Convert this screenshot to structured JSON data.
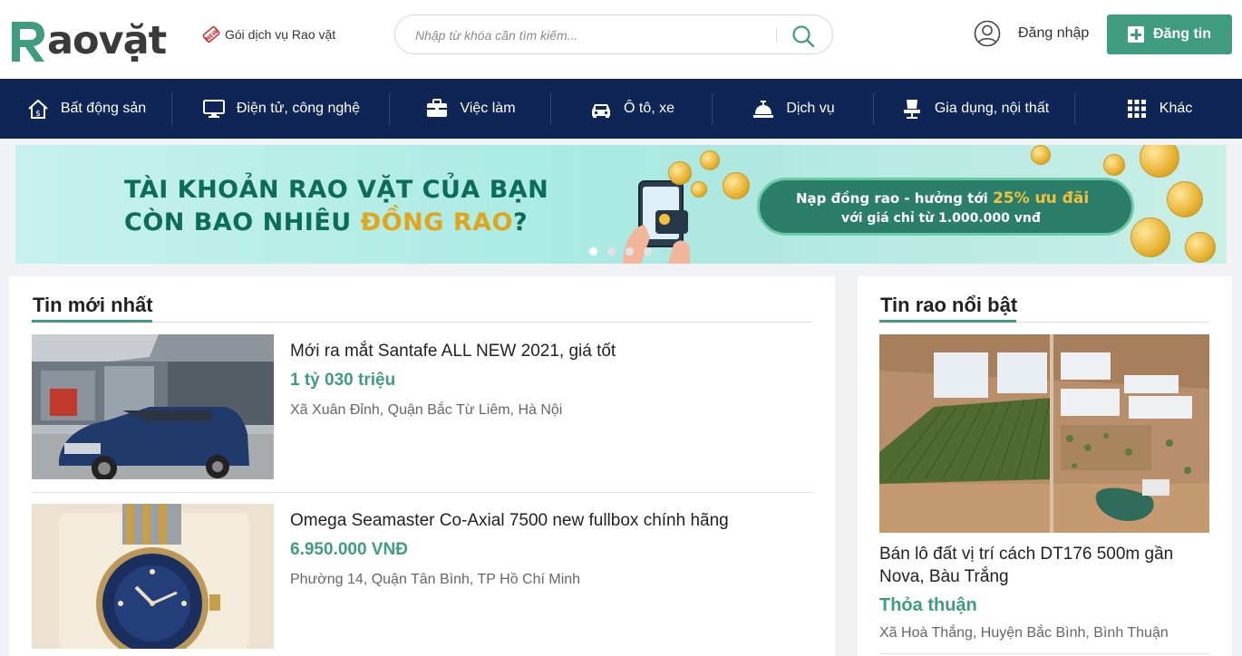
{
  "header": {
    "logo_text": "aovặt",
    "service_link": "Gói dịch vụ Rao vặt",
    "service_tag": "NEW",
    "search_placeholder": "Nhập từ khóa cần tìm kiếm...",
    "login_label": "Đăng nhập",
    "post_label": "Đăng tin"
  },
  "nav": [
    {
      "label": "Bất động sản",
      "icon": "house-icon"
    },
    {
      "label": "Điện tử, công nghệ",
      "icon": "monitor-icon"
    },
    {
      "label": "Việc làm",
      "icon": "briefcase-icon"
    },
    {
      "label": "Ô tô, xe",
      "icon": "car-icon"
    },
    {
      "label": "Dịch vụ",
      "icon": "service-bell-icon"
    },
    {
      "label": "Gia dụng, nội thất",
      "icon": "chair-icon"
    },
    {
      "label": "Khác",
      "icon": "grid-icon"
    }
  ],
  "banner": {
    "line1": "TÀI KHOẢN RAO VẶT CỦA BẠN",
    "line2_a": "CÒN BAO NHIÊU ",
    "line2_hl": "ĐỒNG RAO",
    "line2_b": "?",
    "pill_a": "Nạp đồng rao - hưởng tới ",
    "pill_hl": "25% ưu đãi",
    "pill_line2": "với giá chỉ từ 1.000.000 vnđ"
  },
  "latest": {
    "title": "Tin mới nhất",
    "items": [
      {
        "title": "Mới ra mắt Santafe ALL NEW 2021, giá tốt",
        "price": "1 tỷ 030 triệu",
        "location": "Xã Xuân Đỉnh, Quận Bắc Từ Liêm, Hà Nội"
      },
      {
        "title": "Omega Seamaster Co-Axial 7500 new fullbox chính hãng",
        "price": "6.950.000 VNĐ",
        "location": "Phường 14, Quận Tân Bình, TP Hồ Chí Minh"
      }
    ]
  },
  "featured": {
    "title": "Tin rao nổi bật",
    "item": {
      "title": "Bán lô đất vị trí cách DT176 500m gần Nova, Bàu Trắng",
      "price": "Thỏa thuận",
      "location": "Xã Hoà Thắng, Huyện Bắc Bình, Bình Thuận"
    }
  },
  "colors": {
    "brand_green": "#3f9c7f",
    "nav_navy": "#0e2555"
  }
}
